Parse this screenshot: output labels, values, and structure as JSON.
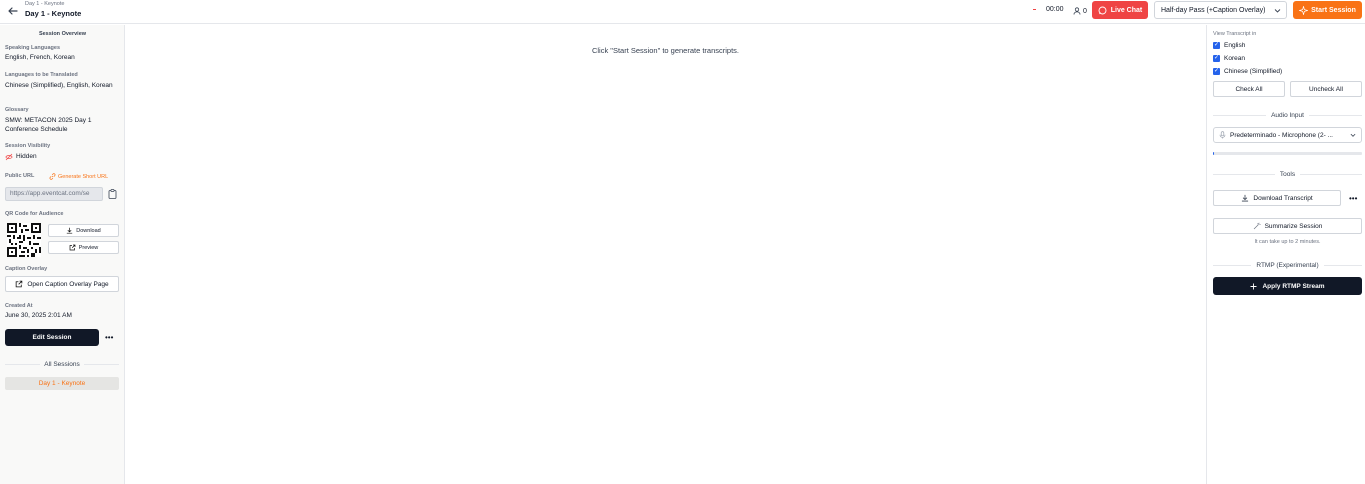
{
  "header": {
    "breadcrumb": "Day 1 - Keynote",
    "title": "Day 1 - Keynote",
    "timer": "00:00",
    "audience_count": "0",
    "live_chat_label": "Live Chat",
    "pass_select_value": "Half-day Pass (+Caption Overlay)",
    "start_session_label": "Start Session"
  },
  "sidebar": {
    "heading": "Session Overview",
    "speaking_languages_label": "Speaking Languages",
    "speaking_languages_value": "English, French, Korean",
    "translated_label": "Languages to be Translated",
    "translated_value": "Chinese (Simplified), English, Korean",
    "glossary_label": "Glossary",
    "glossary_value": "SMW: METACON 2025 Day 1 Conference Schedule",
    "visibility_label": "Session Visibility",
    "visibility_value": "Hidden",
    "public_url_label": "Public URL",
    "generate_short_url": "Generate Short URL",
    "public_url_value": "https://app.eventcat.com/se",
    "qr_label": "QR Code for Audience",
    "download_label": "Download",
    "preview_label": "Preview",
    "caption_overlay_label": "Caption Overlay",
    "open_overlay_label": "Open Caption Overlay Page",
    "created_label": "Created At",
    "created_value": "June 30, 2025 2:01 AM",
    "edit_session_label": "Edit Session",
    "more_label": "•••",
    "all_sessions_label": "All Sessions",
    "sessions": [
      "Day 1 - Keynote"
    ]
  },
  "main": {
    "empty_message": "Click \"Start Session\" to generate transcripts."
  },
  "right_panel": {
    "view_transcript_label": "View Transcript in",
    "languages": [
      {
        "label": "English",
        "checked": true
      },
      {
        "label": "Korean",
        "checked": true
      },
      {
        "label": "Chinese (Simplified)",
        "checked": true
      }
    ],
    "check_all_label": "Check All",
    "uncheck_all_label": "Uncheck All",
    "audio_input_label": "Audio Input",
    "mic_value": "Predeterminado - Microphone (2- ...",
    "audio_level": 0.01,
    "tools_label": "Tools",
    "download_transcript_label": "Download Transcript",
    "more_label": "•••",
    "summarize_label": "Summarize Session",
    "summarize_note": "It can take up to 2 minutes.",
    "rtmp_label": "RTMP (Experimental)",
    "apply_rtmp_label": "Apply RTMP Stream"
  },
  "colors": {
    "accent_orange": "#f97316",
    "live_red": "#ef4444",
    "primary_dark": "#111827",
    "checkbox_blue": "#2563eb"
  }
}
